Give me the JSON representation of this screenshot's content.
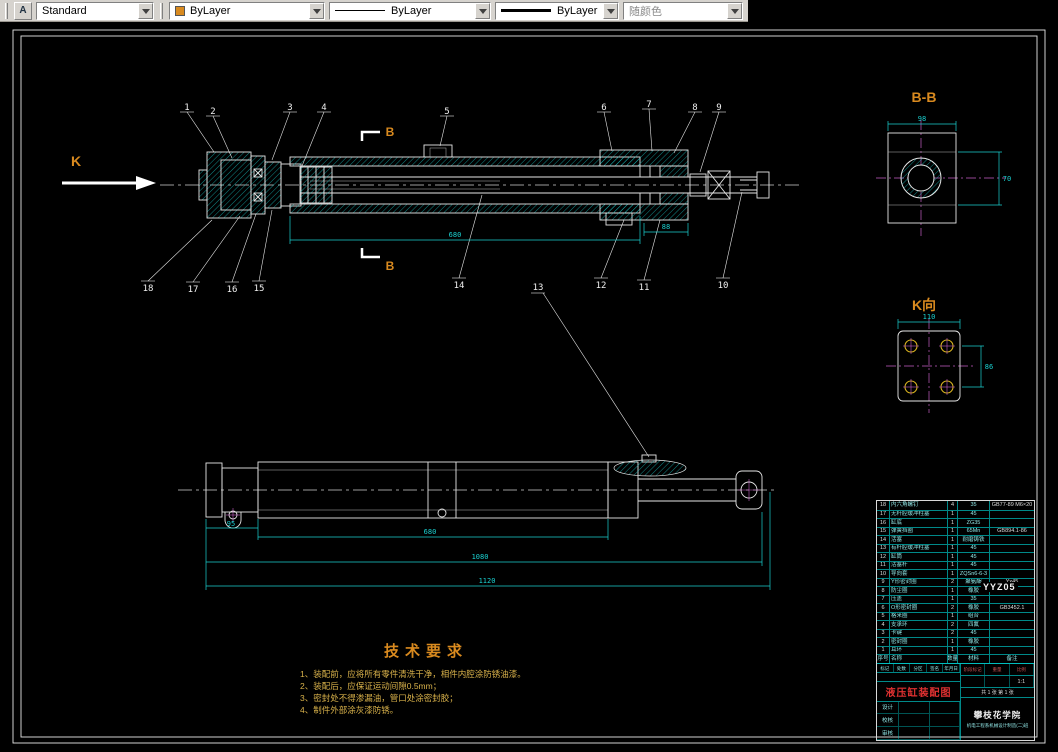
{
  "toolbar": {
    "style_icon_glyph": "A",
    "style_label": "Standard",
    "color_label": "ByLayer",
    "linetype_label": "ByLayer",
    "lineweight_label": "ByLayer",
    "plotstyle_label": "随颜色"
  },
  "colors": {
    "background": "#000000",
    "line": "#e6e6e6",
    "dimension": "#1ad1d1",
    "accent_orange": "#d98a1f",
    "centerline_magenta": "#c45ec4",
    "title_red": "#e03131"
  },
  "drawing": {
    "k_label": "K",
    "b_upper": "B",
    "b_lower": "B",
    "bb_title": "B-B",
    "k_view_title": "K向",
    "callouts_top": [
      "1",
      "2",
      "3",
      "4",
      "5",
      "6",
      "7",
      "8",
      "9"
    ],
    "callouts_bottom": [
      "18",
      "17",
      "16",
      "15",
      "14",
      "13",
      "12",
      "11",
      "10"
    ],
    "dims": {
      "main_width": "680",
      "main_small": "88",
      "bb_width": "98",
      "bb_height": "70",
      "k_width": "110",
      "k_height": "86",
      "low_small": "95",
      "low_mid": "680",
      "low_len": "1080",
      "low_total": "1120"
    }
  },
  "tech": {
    "title": "技术要求",
    "items": [
      "1、装配前，应将所有零件清洗干净，相件内腔涂防锈油漆。",
      "2、装配后，应保证运动间隙0.5mm；",
      "3、密封处不得渗漏油，管口处涂密封胶；",
      "4、制件外部涂灰漆防锈。"
    ]
  },
  "title_block": {
    "code": "YYZ05",
    "drawing_title": "液压缸装配图",
    "school": "攀枝花学院",
    "dept": "机电工程系机械设计制造(二)班",
    "scale_label": "比例",
    "scale_value": "1:1",
    "weight_label": "重量",
    "stage_label": "阶段标记",
    "sheets": "共 1 张 第 1 张",
    "marks_row": [
      "标记",
      "处数",
      "分区",
      "签名",
      "年月日"
    ],
    "sign_rows": [
      {
        "label": "设计"
      },
      {
        "label": "校核"
      },
      {
        "label": "审核"
      }
    ],
    "bom_header": {
      "no": "序号",
      "name": "名称",
      "qty": "数量",
      "mat": "材料",
      "note": "备注"
    },
    "bom_rows": [
      {
        "no": "18",
        "name": "内六角螺钉",
        "qty": "4",
        "mat": "35",
        "note": "GB77-89 M6×20"
      },
      {
        "no": "17",
        "name": "无杆腔缓冲柱塞",
        "qty": "1",
        "mat": "45",
        "note": ""
      },
      {
        "no": "16",
        "name": "缸底",
        "qty": "1",
        "mat": "ZG35",
        "note": ""
      },
      {
        "no": "15",
        "name": "弹簧挡圈",
        "qty": "1",
        "mat": "65Mn",
        "note": "GB894.1-86"
      },
      {
        "no": "14",
        "name": "活塞",
        "qty": "1",
        "mat": "耐磨铸铁",
        "note": ""
      },
      {
        "no": "13",
        "name": "有杆腔缓冲柱塞",
        "qty": "1",
        "mat": "45",
        "note": ""
      },
      {
        "no": "12",
        "name": "缸筒",
        "qty": "1",
        "mat": "45",
        "note": ""
      },
      {
        "no": "11",
        "name": "活塞杆",
        "qty": "1",
        "mat": "45",
        "note": ""
      },
      {
        "no": "10",
        "name": "导向套",
        "qty": "1",
        "mat": "ZQSn6-6-3",
        "note": ""
      },
      {
        "no": "9",
        "name": "Y形密封圈",
        "qty": "2",
        "mat": "聚氨酯",
        "note": "Yx45"
      },
      {
        "no": "8",
        "name": "防尘圈",
        "qty": "1",
        "mat": "橡胶",
        "note": ""
      },
      {
        "no": "7",
        "name": "压盖",
        "qty": "1",
        "mat": "35",
        "note": ""
      },
      {
        "no": "6",
        "name": "O形密封圈",
        "qty": "2",
        "mat": "橡胶",
        "note": "GB3452.1"
      },
      {
        "no": "5",
        "name": "格来圈",
        "qty": "1",
        "mat": "组合",
        "note": ""
      },
      {
        "no": "4",
        "name": "支承环",
        "qty": "2",
        "mat": "四氟",
        "note": ""
      },
      {
        "no": "3",
        "name": "卡键",
        "qty": "2",
        "mat": "45",
        "note": ""
      },
      {
        "no": "2",
        "name": "密封圈",
        "qty": "1",
        "mat": "橡胶",
        "note": ""
      },
      {
        "no": "1",
        "name": "耳环",
        "qty": "1",
        "mat": "45",
        "note": ""
      }
    ]
  }
}
